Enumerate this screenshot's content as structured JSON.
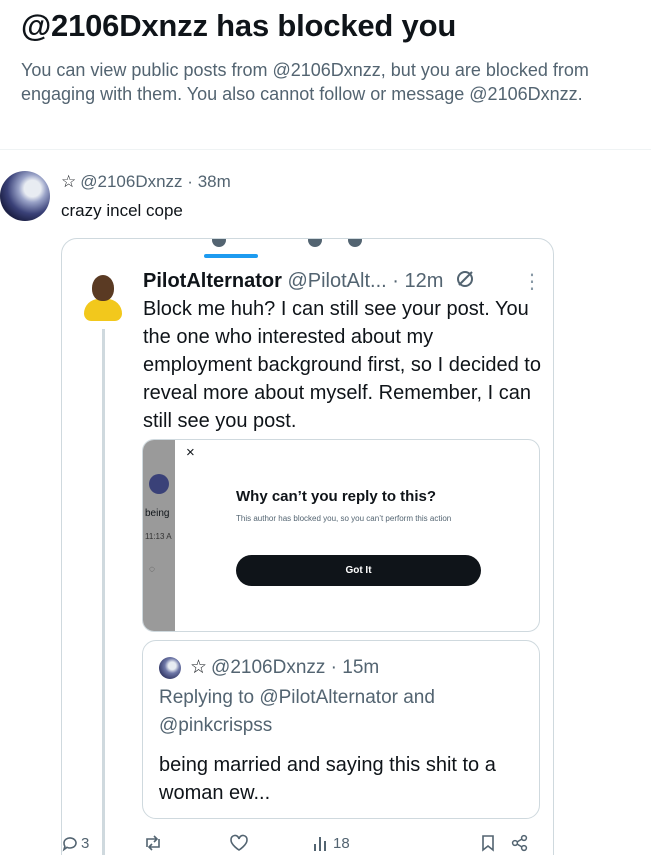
{
  "header": {
    "title": "@2106Dxnzz has blocked you",
    "description": "You can view public posts from @2106Dxnzz, but you are blocked from engaging with them. You also cannot follow or message @2106Dxnzz."
  },
  "tweet": {
    "star": "☆",
    "handle": "@2106Dxnzz",
    "sep": "·",
    "time": "38m",
    "text": "crazy incel cope"
  },
  "screenshot": {
    "author_name": "PilotAlternator",
    "author_handle": "@PilotAlt...",
    "time": "· 12m",
    "more": "⋮",
    "text": "Block me huh? I can still see your post. You the one who interested about my employment background first, so I decided to reveal more about myself. Remember, I can still see you post.",
    "dialog": {
      "close": "×",
      "title": "Why can’t you reply to this?",
      "description": "This author has blocked you, so you can’t perform this action",
      "button": "Got It",
      "bg_word": "being",
      "bg_time": "11:13 A"
    },
    "quote": {
      "star": "☆",
      "handle": "@2106Dxnzz",
      "time": "· 15m",
      "replying": "Replying to @PilotAlternator and @pinkcrispss",
      "text": "being married and saying this shit to a woman ew..."
    },
    "actions": {
      "reply_count": "3",
      "views": "18"
    }
  },
  "colors": {
    "text_primary": "#0f1419",
    "text_secondary": "#536471",
    "accent": "#1d9bf0",
    "border": "#cfd9de"
  }
}
